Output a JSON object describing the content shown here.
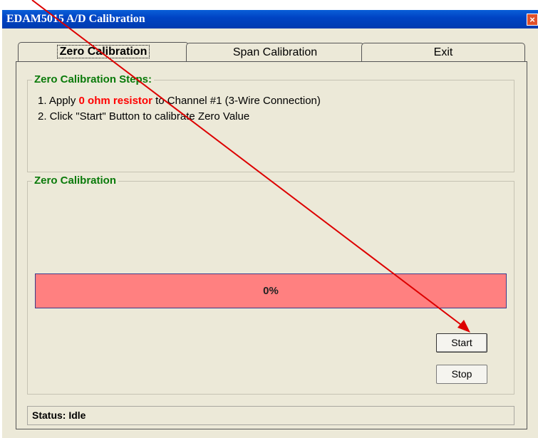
{
  "window": {
    "title": "EDAM5015 A/D Calibration",
    "close_glyph": "×"
  },
  "tabs": [
    {
      "label": "Zero Calibration",
      "active": true
    },
    {
      "label": "Span Calibration",
      "active": false
    },
    {
      "label": "Exit",
      "active": false
    }
  ],
  "steps_group": {
    "title": "Zero Calibration Steps:",
    "step1_prefix": "1. Apply ",
    "step1_highlight": "0 ohm resistor",
    "step1_suffix": " to Channel #1 (3-Wire Connection)",
    "step2": "2. Click \"Start\" Button to calibrate Zero Value"
  },
  "calibration_group": {
    "title": "Zero Calibration",
    "progress_text": "0%",
    "progress_value": 0
  },
  "buttons": {
    "start": "Start",
    "stop": "Stop"
  },
  "status": "Status: Idle",
  "colors": {
    "accent_red": "#ff0000",
    "progress_fill": "#ff8080",
    "group_title": "#0a7a0a"
  }
}
